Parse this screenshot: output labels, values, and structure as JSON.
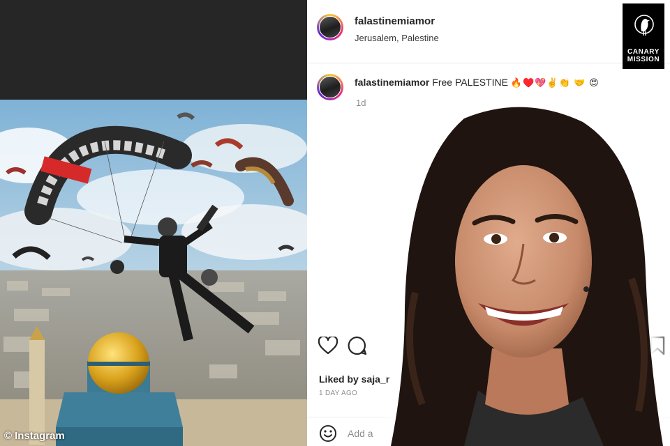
{
  "left_panel": {
    "credit_symbol": "©",
    "credit_text": "Instagram"
  },
  "post": {
    "username": "falastinemiamor",
    "location": "Jerusalem, Palestine",
    "caption_username": "falastinemiamor",
    "caption_text": "Free PALESTINE",
    "caption_emoji": "🔥♥️💖✌️👏 🤝 😍",
    "caption_age": "1d",
    "likes_text": "Liked by saja_r",
    "post_age": "1 DAY AGO",
    "comment_placeholder": "Add a"
  },
  "icons": {
    "like": "heart-icon",
    "comment": "comment-bubble-icon",
    "save": "bookmark-icon",
    "emoji": "smiley-icon",
    "badge": "canary-bird-icon"
  },
  "badge": {
    "line1": "CANARY",
    "line2": "MISSION"
  },
  "colors": {
    "ig_text": "#262626",
    "ig_muted": "#8e8e8e",
    "left_topbar": "#262626",
    "badge_bg": "#000000"
  }
}
